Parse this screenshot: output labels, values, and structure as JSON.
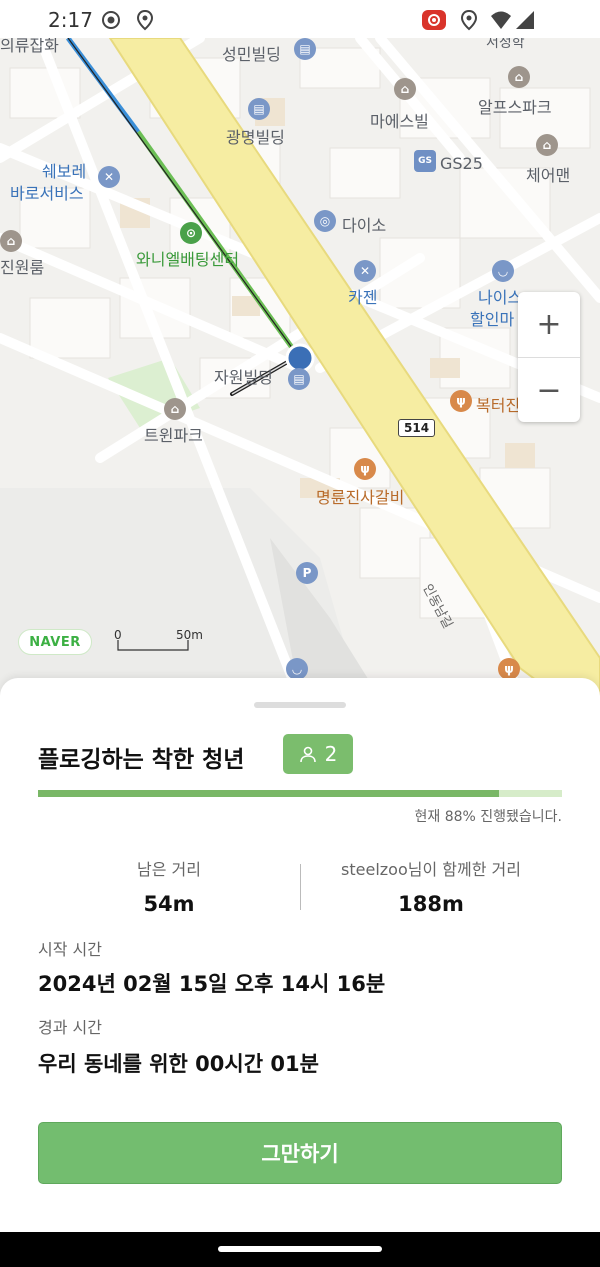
{
  "status_bar": {
    "time": "2:17",
    "icons": [
      "record-icon",
      "location-icon",
      "cast-icon",
      "location-icon",
      "wifi-icon",
      "signal-icon"
    ]
  },
  "map": {
    "pois": [
      {
        "label": "의류잡화",
        "kind": "gray"
      },
      {
        "label": "서정학",
        "kind": "gray"
      },
      {
        "label": "성민빌딩",
        "kind": "gray"
      },
      {
        "label": "마에스빌",
        "kind": "gray"
      },
      {
        "label": "알프스파크",
        "kind": "gray"
      },
      {
        "label": "광명빌딩",
        "kind": "gray"
      },
      {
        "label": "GS25",
        "kind": "gray"
      },
      {
        "label": "체어맨",
        "kind": "gray"
      },
      {
        "label": "쉐보레",
        "kind": "blue"
      },
      {
        "label": "바로서비스",
        "kind": "blue"
      },
      {
        "label": "다이소",
        "kind": "gray"
      },
      {
        "label": "와니엘배팅센터",
        "kind": "green"
      },
      {
        "label": "진원룸",
        "kind": "gray"
      },
      {
        "label": "카젠",
        "kind": "blue"
      },
      {
        "label": "나이스",
        "kind": "blue"
      },
      {
        "label": "할인마",
        "kind": "blue"
      },
      {
        "label": "자원빌딩",
        "kind": "gray"
      },
      {
        "label": "복터진",
        "kind": "orange"
      },
      {
        "label": "트윈파크",
        "kind": "gray"
      },
      {
        "label": "명륜진사갈비",
        "kind": "orange"
      },
      {
        "label": "인동남길",
        "kind": "gray"
      }
    ],
    "route_number": "514",
    "zoom_in": "+",
    "zoom_out": "−",
    "brand": "NAVER",
    "scale_zero": "0",
    "scale_label": "50m",
    "colors": {
      "main_road": "#f6eda2",
      "route_green": "#6cbf55",
      "route_blue": "#3b8fd8",
      "location_dot": "#3b6fb6"
    }
  },
  "sheet": {
    "title": "플로깅하는 착한 청년",
    "participants": "2",
    "progress_percent": 88,
    "progress_text": "현재 88% 진행됐습니다.",
    "remaining_label": "남은 거리",
    "remaining_value": "54m",
    "together_label": "steelzoo님이 함께한 거리",
    "together_value": "188m",
    "start_label": "시작 시간",
    "start_value": "2024년 02월 15일 오후 14시 16분",
    "elapsed_label": "경과 시간",
    "elapsed_value": "우리 동네를 위한 00시간 01분",
    "stop_button": "그만하기",
    "colors": {
      "accent": "#73bd6f",
      "badge": "#7bbd6d"
    }
  }
}
